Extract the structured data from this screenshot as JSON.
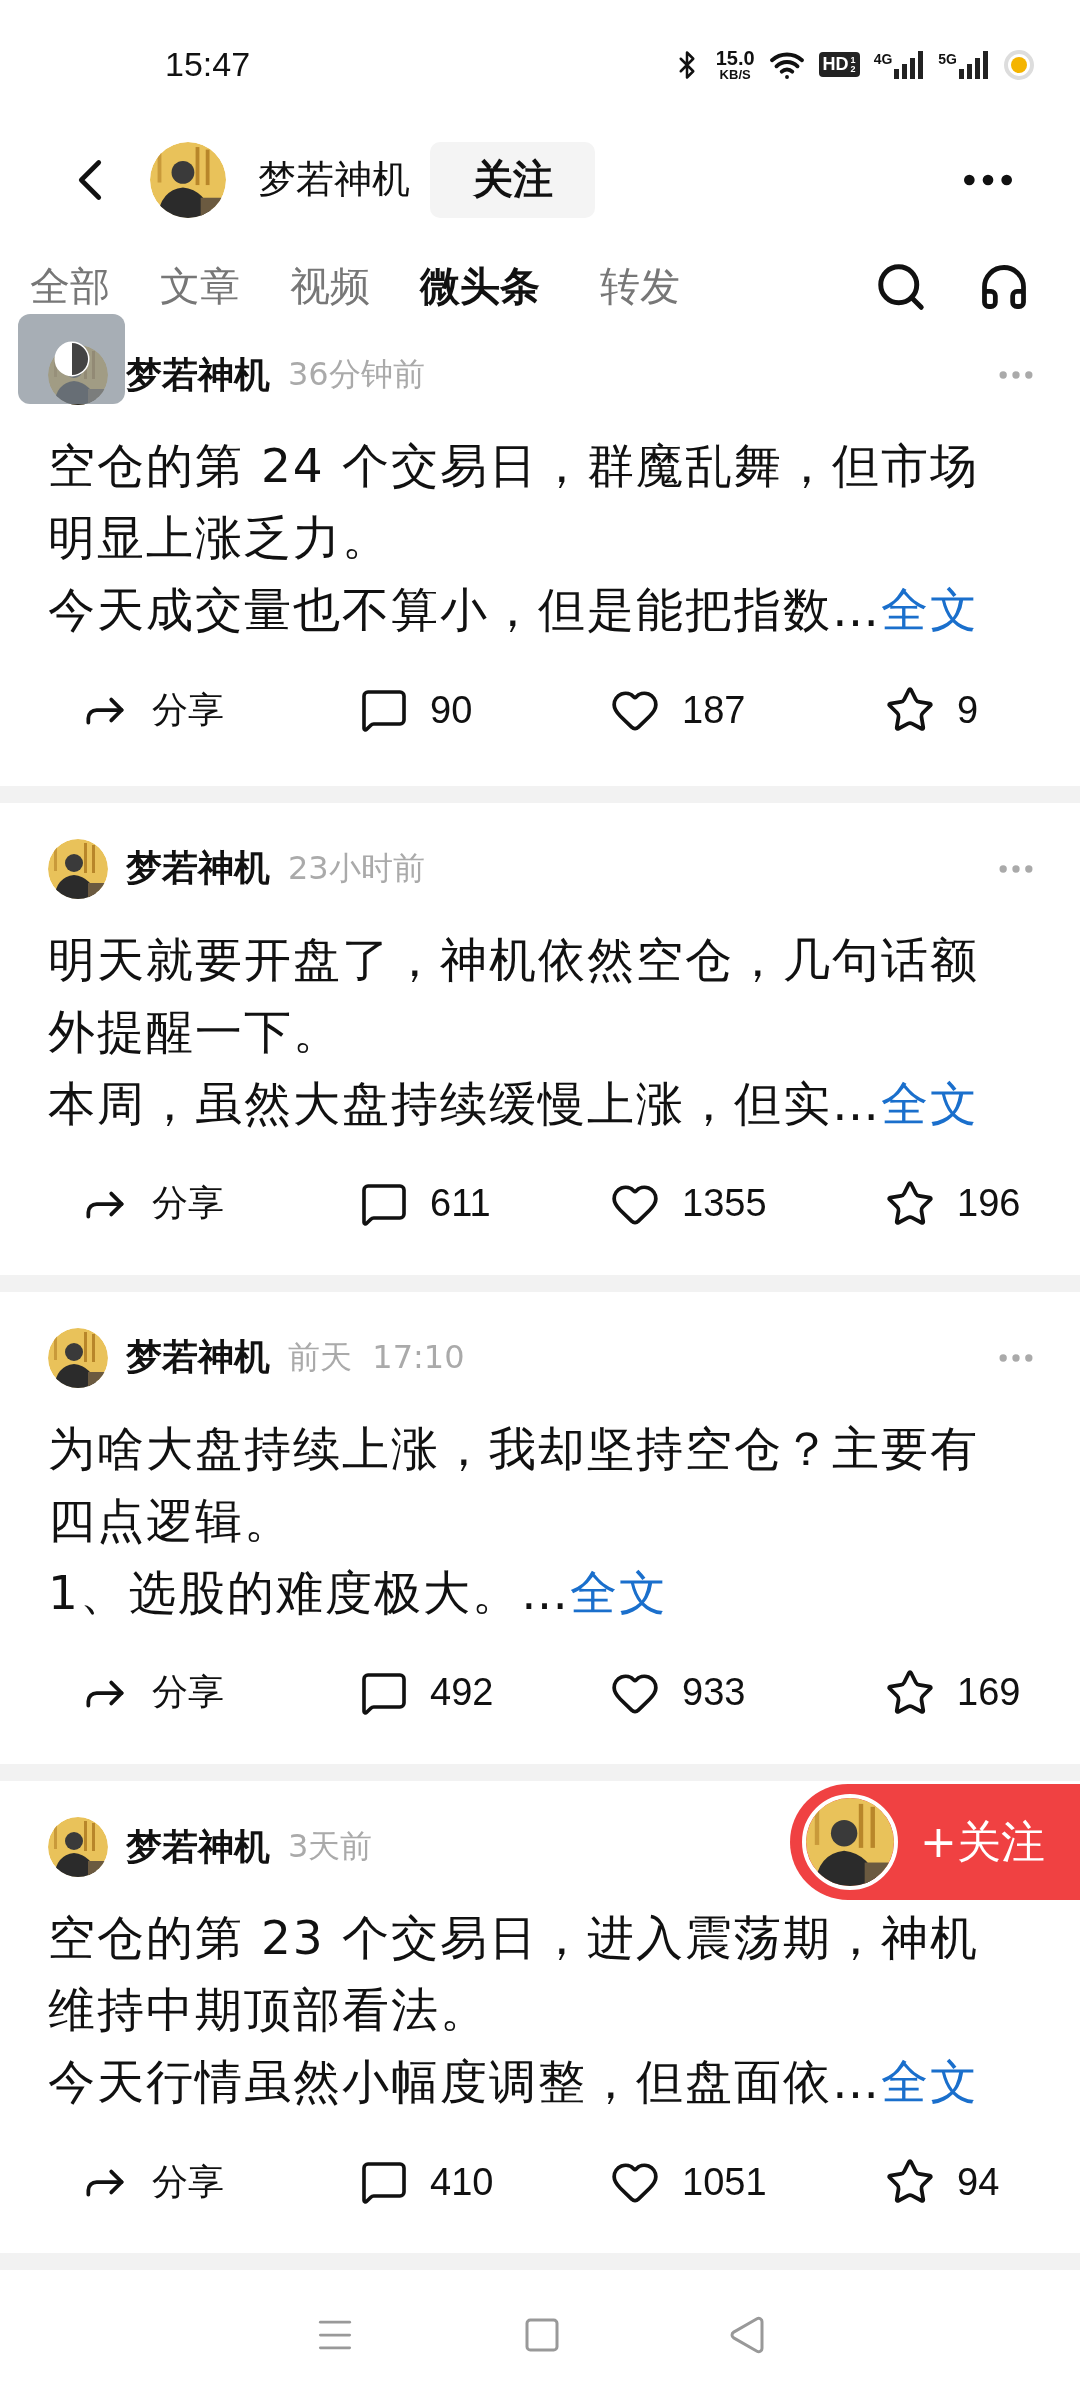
{
  "status_bar": {
    "time": "15:47",
    "speed": "15.0",
    "speed_unit": "KB/S",
    "hd": {
      "label": "HD",
      "sup": "1",
      "sub": "2"
    },
    "networks": [
      "4G",
      "5G"
    ]
  },
  "header": {
    "name": "梦若神机",
    "follow": "关注"
  },
  "tabs": [
    {
      "label": "全部",
      "selected": false
    },
    {
      "label": "文章",
      "selected": false
    },
    {
      "label": "视频",
      "selected": false
    },
    {
      "label": "微头条",
      "selected": true
    },
    {
      "label": "转发",
      "selected": false
    }
  ],
  "posts": [
    {
      "author": "梦若神机",
      "time": "36分钟前",
      "lines": [
        "空仓的第 24 个交易日，群魔乱舞，但市场",
        "明显上涨乏力。"
      ],
      "excerpt": "今天成交量也不算小，但是能把指数…",
      "more": "全文",
      "share": "分享",
      "comments": "90",
      "likes": "187",
      "favorites": "9",
      "menu_visible": true
    },
    {
      "author": "梦若神机",
      "time": "23小时前",
      "lines": [
        "明天就要开盘了，神机依然空仓，几句话额",
        "外提醒一下。"
      ],
      "excerpt": "本周，虽然大盘持续缓慢上涨，但实…",
      "more": "全文",
      "share": "分享",
      "comments": "611",
      "likes": "1355",
      "favorites": "196",
      "menu_visible": true
    },
    {
      "author": "梦若神机",
      "time": "前天  17:10",
      "lines": [
        "为啥大盘持续上涨，我却坚持空仓？主要有",
        "四点逻辑。"
      ],
      "excerpt": "1、选股的难度极大。…",
      "more": "全文",
      "share": "分享",
      "comments": "492",
      "likes": "933",
      "favorites": "169",
      "menu_visible": true
    },
    {
      "author": "梦若神机",
      "time": "3天前",
      "lines": [
        "空仓的第 23 个交易日，进入震荡期，神机",
        "维持中期顶部看法。"
      ],
      "excerpt": "今天行情虽然小幅度调整，但盘面依…",
      "more": "全文",
      "share": "分享",
      "comments": "410",
      "likes": "1051",
      "favorites": "94",
      "menu_visible": false
    }
  ],
  "floating_follow": {
    "label": "+关注"
  }
}
